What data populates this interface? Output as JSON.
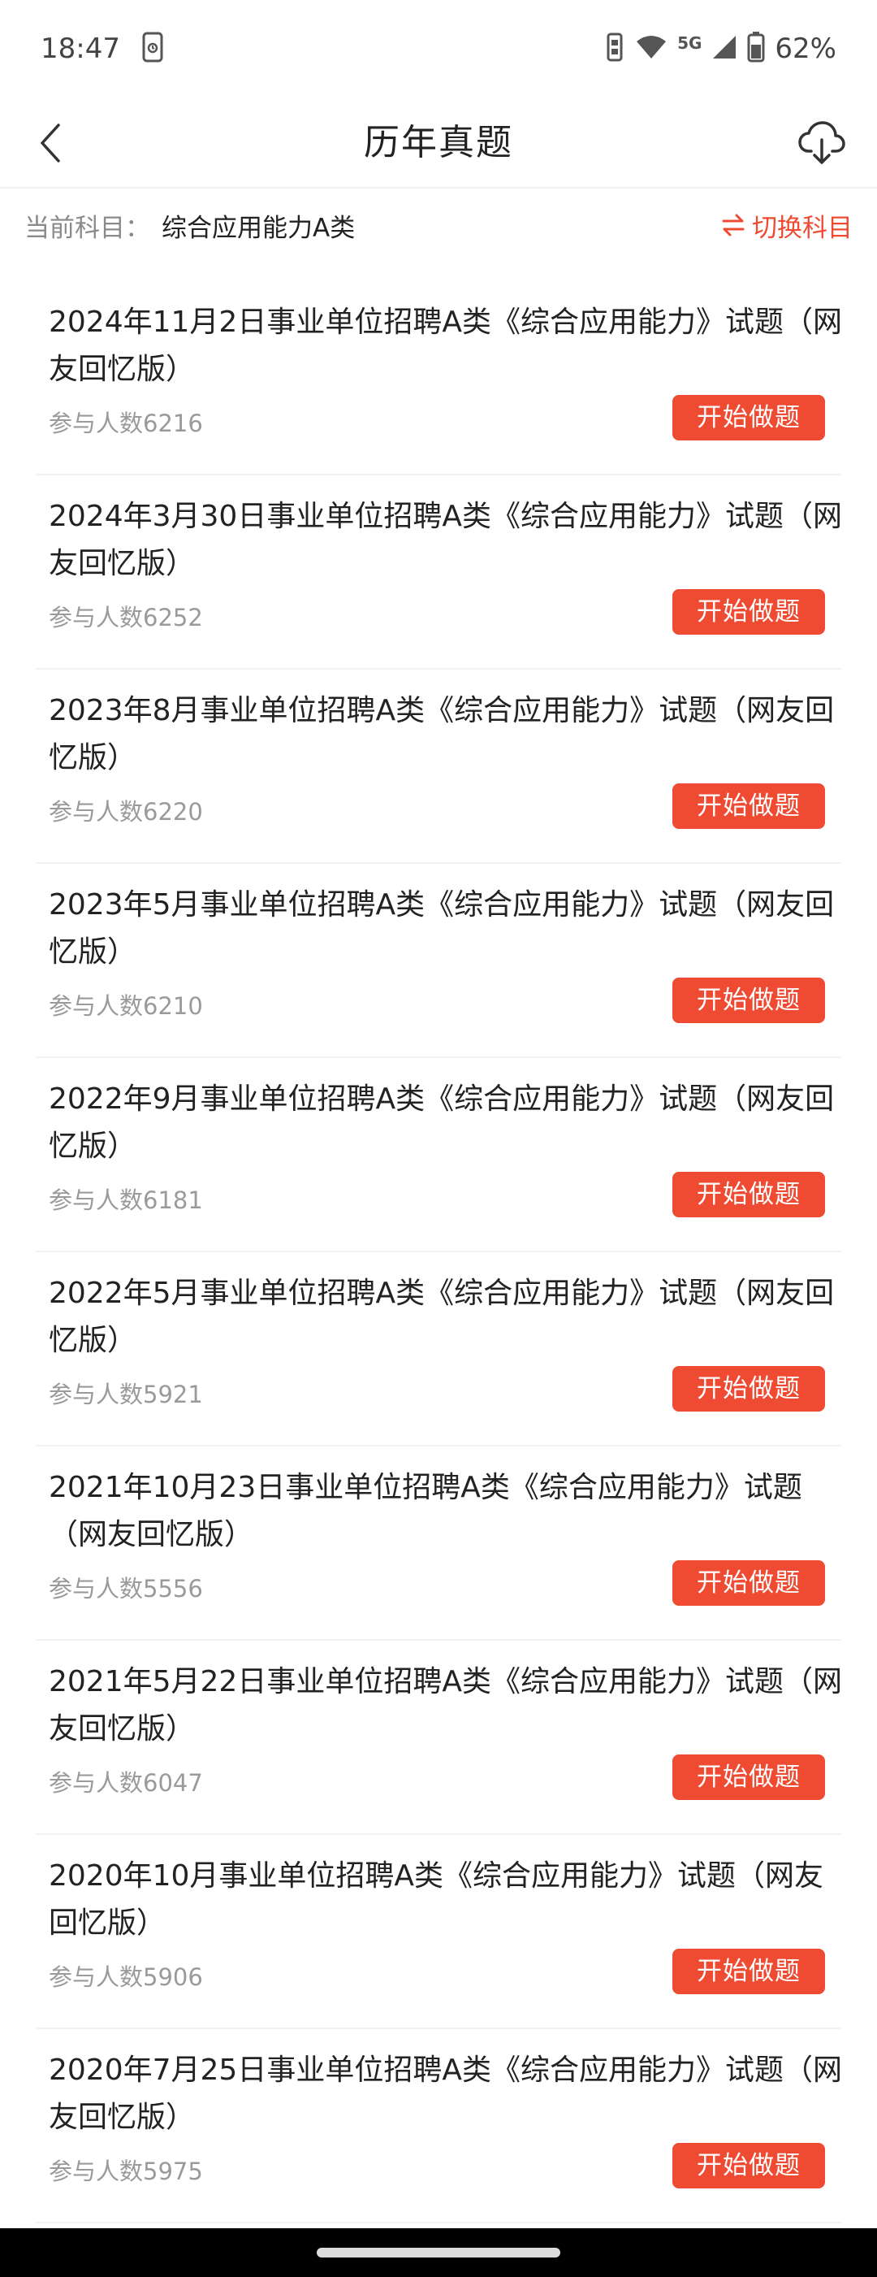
{
  "status_bar": {
    "time": "18:47",
    "battery": "62%",
    "network": "5G",
    "icons": [
      "phone-icon",
      "vibrate-icon",
      "wifi-icon",
      "signal-icon",
      "battery-icon"
    ]
  },
  "header": {
    "title": "历年真题",
    "back_icon": "chevron-left-icon",
    "download_icon": "cloud-download-icon"
  },
  "subject": {
    "label": "当前科目：",
    "value": "综合应用能力A类",
    "switch_label": "切换科目",
    "switch_icon": "swap-icon"
  },
  "colors": {
    "accent": "#ef4b33",
    "text_primary": "#222222",
    "text_secondary": "#9a9a9a"
  },
  "exams": [
    {
      "title": "2024年11月2日事业单位招聘A类《综合应用能力》试题（网友回忆版）",
      "count": "参与人数6216",
      "button": "开始做题"
    },
    {
      "title": "2024年3月30日事业单位招聘A类《综合应用能力》试题（网友回忆版）",
      "count": "参与人数6252",
      "button": "开始做题"
    },
    {
      "title": "2023年8月事业单位招聘A类《综合应用能力》试题（网友回忆版）",
      "count": "参与人数6220",
      "button": "开始做题"
    },
    {
      "title": "2023年5月事业单位招聘A类《综合应用能力》试题（网友回忆版）",
      "count": "参与人数6210",
      "button": "开始做题"
    },
    {
      "title": "2022年9月事业单位招聘A类《综合应用能力》试题（网友回忆版）",
      "count": "参与人数6181",
      "button": "开始做题"
    },
    {
      "title": "2022年5月事业单位招聘A类《综合应用能力》试题（网友回忆版）",
      "count": "参与人数5921",
      "button": "开始做题"
    },
    {
      "title": "2021年10月23日事业单位招聘A类《综合应用能力》试题（网友回忆版）",
      "count": "参与人数5556",
      "button": "开始做题"
    },
    {
      "title": "2021年5月22日事业单位招聘A类《综合应用能力》试题（网友回忆版）",
      "count": "参与人数6047",
      "button": "开始做题"
    },
    {
      "title": "2020年10月事业单位招聘A类《综合应用能力》试题（网友回忆版）",
      "count": "参与人数5906",
      "button": "开始做题"
    },
    {
      "title": "2020年7月25日事业单位招聘A类《综合应用能力》试题（网友回忆版）",
      "count": "参与人数5975",
      "button": "开始做题"
    }
  ]
}
